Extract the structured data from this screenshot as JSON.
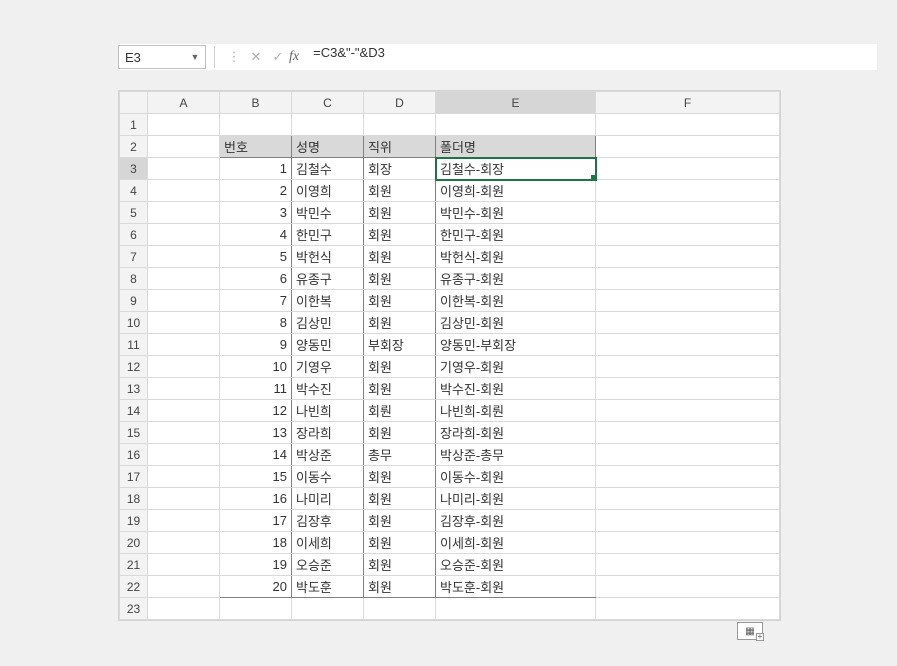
{
  "formula_bar": {
    "name_box": "E3",
    "formula": "=C3&\"-\"&D3",
    "cancel_icon": "✕",
    "enter_icon": "✓",
    "dots_icon": "⋮"
  },
  "columns": [
    "A",
    "B",
    "C",
    "D",
    "E",
    "F"
  ],
  "row_headers": [
    "1",
    "2",
    "3",
    "4",
    "5",
    "6",
    "7",
    "8",
    "9",
    "10",
    "11",
    "12",
    "13",
    "14",
    "15",
    "16",
    "17",
    "18",
    "19",
    "20",
    "21",
    "22",
    "23"
  ],
  "headers": {
    "B": "번호",
    "C": "성명",
    "D": "직위",
    "E": "폴더명"
  },
  "chart_data": {
    "type": "table",
    "columns": [
      "번호",
      "성명",
      "직위",
      "폴더명"
    ],
    "rows": [
      {
        "num": "1",
        "name": "김철수",
        "title": "회장",
        "folder": "김철수-회장"
      },
      {
        "num": "2",
        "name": "이영희",
        "title": "회원",
        "folder": "이영희-회원"
      },
      {
        "num": "3",
        "name": "박민수",
        "title": "회원",
        "folder": "박민수-회원"
      },
      {
        "num": "4",
        "name": "한민구",
        "title": "회원",
        "folder": "한민구-회원"
      },
      {
        "num": "5",
        "name": "박헌식",
        "title": "회원",
        "folder": "박헌식-회원"
      },
      {
        "num": "6",
        "name": "유종구",
        "title": "회원",
        "folder": "유종구-회원"
      },
      {
        "num": "7",
        "name": "이한복",
        "title": "회원",
        "folder": "이한복-회원"
      },
      {
        "num": "8",
        "name": "김상민",
        "title": "회원",
        "folder": "김상민-회원"
      },
      {
        "num": "9",
        "name": "양동민",
        "title": "부회장",
        "folder": "양동민-부회장"
      },
      {
        "num": "10",
        "name": "기영우",
        "title": "회원",
        "folder": "기영우-회원"
      },
      {
        "num": "11",
        "name": "박수진",
        "title": "회원",
        "folder": "박수진-회원"
      },
      {
        "num": "12",
        "name": "나빈희",
        "title": "회뤈",
        "folder": "나빈희-회뤈"
      },
      {
        "num": "13",
        "name": "장라희",
        "title": "회원",
        "folder": "장라희-회원"
      },
      {
        "num": "14",
        "name": "박상준",
        "title": "총무",
        "folder": "박상준-총무"
      },
      {
        "num": "15",
        "name": "이동수",
        "title": "회원",
        "folder": "이동수-회원"
      },
      {
        "num": "16",
        "name": "나미리",
        "title": "회원",
        "folder": "나미리-회원"
      },
      {
        "num": "17",
        "name": "김장후",
        "title": "회원",
        "folder": "김장후-회원"
      },
      {
        "num": "18",
        "name": "이세희",
        "title": "회원",
        "folder": "이세희-회원"
      },
      {
        "num": "19",
        "name": "오승준",
        "title": "회원",
        "folder": "오승준-회원"
      },
      {
        "num": "20",
        "name": "박도훈",
        "title": "회원",
        "folder": "박도훈-회원"
      }
    ]
  },
  "autofill_icon": "▦",
  "active_cell": "E3",
  "active_col": "E",
  "active_row": "3"
}
